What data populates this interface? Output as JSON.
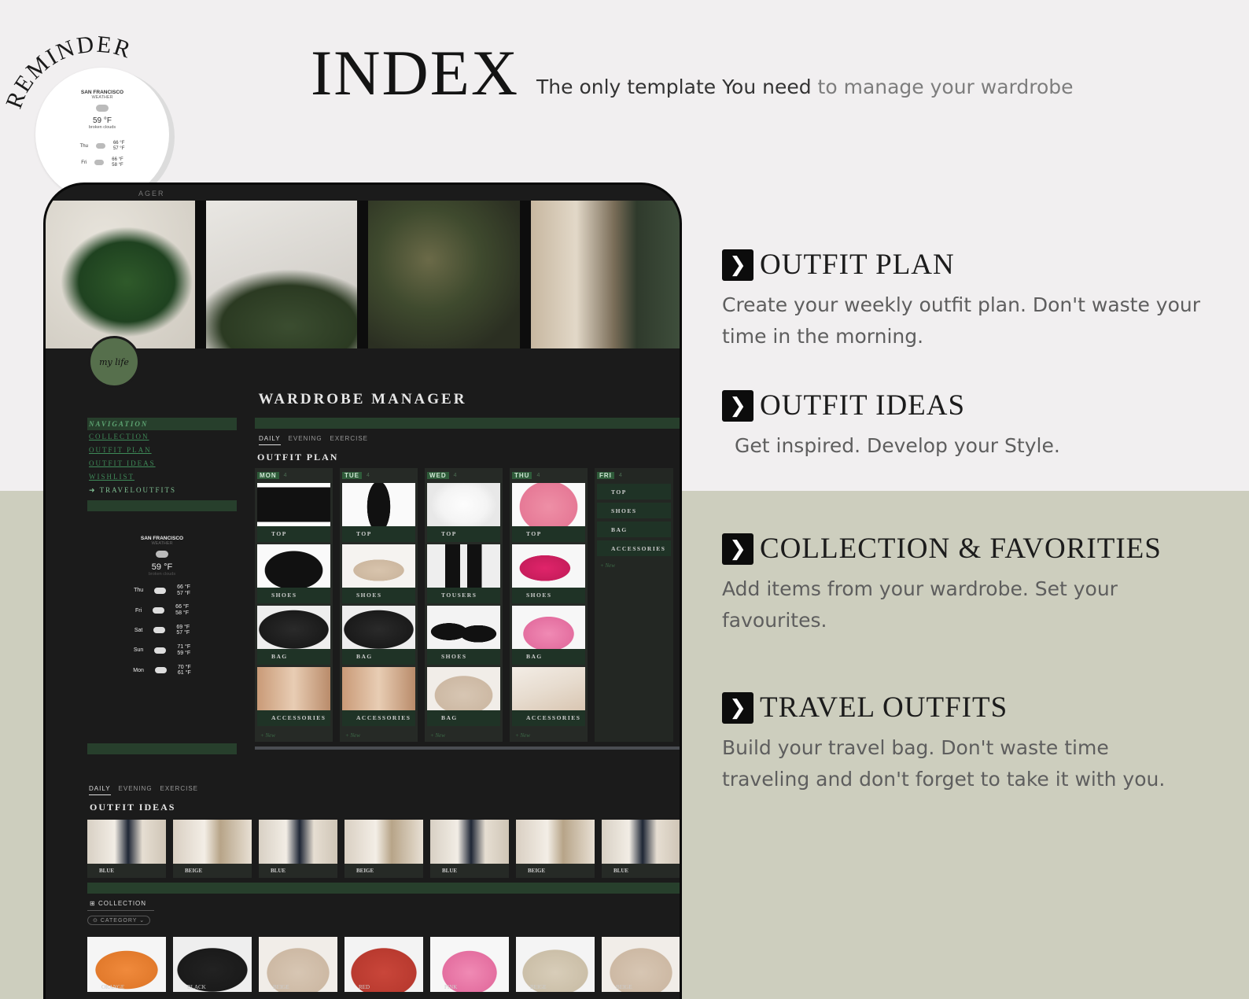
{
  "header": {
    "title": "INDEX",
    "tagline_dark": "The only template You need",
    "tagline_light": "to manage your wardrobe"
  },
  "reminder": {
    "label": "REMINDER",
    "city": "SAN FRANCISCO",
    "subtitle": "WEATHER",
    "temp": "59 °F",
    "desc": "broken clouds",
    "days": [
      {
        "day": "Thu",
        "high": "66 °F",
        "low": "57 °F"
      },
      {
        "day": "Fri",
        "high": "66 °F",
        "low": "58 °F"
      }
    ]
  },
  "app": {
    "top_label": "AGER",
    "avatar_text": "my life",
    "title": "WARDROBE MANAGER",
    "nav": {
      "header": "NAVIGATION",
      "items": [
        "COLLECTION",
        "OUTFIT PLAN",
        "OUTFIT IDEAS",
        "WISHLIST",
        "TRAVELOUTFITS"
      ]
    },
    "weather": {
      "city": "SAN FRANCISCO",
      "subtitle": "WEATHER",
      "temp": "59 °F",
      "desc": "broken clouds",
      "days": [
        {
          "day": "Thu",
          "high": "66 °F",
          "low": "57 °F"
        },
        {
          "day": "Fri",
          "high": "66 °F",
          "low": "58 °F"
        },
        {
          "day": "Sat",
          "high": "69 °F",
          "low": "57 °F"
        },
        {
          "day": "Sun",
          "high": "71 °F",
          "low": "59 °F"
        },
        {
          "day": "Mon",
          "high": "70 °F",
          "low": "61 °F"
        }
      ]
    },
    "tabs": [
      "DAILY",
      "EVENING",
      "EXERCISE"
    ],
    "outfit_plan": {
      "title": "OUTFIT PLAN",
      "new_label": "+ New",
      "columns": [
        {
          "day": "MON",
          "count": "4",
          "items": [
            "TOP",
            "SHOES",
            "BAG",
            "ACCESSORIES"
          ]
        },
        {
          "day": "TUE",
          "count": "4",
          "items": [
            "TOP",
            "SHOES",
            "BAG",
            "ACCESSORIES"
          ]
        },
        {
          "day": "WED",
          "count": "4",
          "items": [
            "TOP",
            "TOUSERS",
            "SHOES",
            "BAG"
          ]
        },
        {
          "day": "THU",
          "count": "4",
          "items": [
            "TOP",
            "SHOES",
            "BAG",
            "ACCESSORIES"
          ]
        }
      ],
      "fri": {
        "day": "FRI",
        "count": "4",
        "items": [
          "TOP",
          "SHOES",
          "BAG",
          "ACCESSORIES"
        ]
      }
    },
    "outfit_ideas": {
      "title": "OUTFIT IDEAS",
      "items": [
        "BLUE",
        "BEIGE",
        "BLUE",
        "BEIGE",
        "BLUE",
        "BEIGE",
        "BLUE"
      ]
    },
    "collection": {
      "tab": "COLLECTION",
      "filter": "CATEGORY",
      "items": [
        "ORANGE",
        "BLACK",
        "BEIGE",
        "RED",
        "PINK",
        "BEIGE",
        "BEIGE"
      ]
    }
  },
  "sections": [
    {
      "title": "OUTFIT PLAN",
      "desc": "Create your weekly outfit plan. Don't waste your time in the morning."
    },
    {
      "title": "OUTFIT IDEAS",
      "desc": "Get inspired. Develop your Style."
    },
    {
      "title": "COLLECTION & FAVORITIES",
      "desc": "Add items from your wardrobe. Set your favourites."
    },
    {
      "title": "TRAVEL OUTFITS",
      "desc": "Build your travel bag. Don't waste time traveling and don't forget to take it with you."
    }
  ],
  "colors": {
    "accent_green": "#273f2c",
    "bottom_bg": "#cdcebe",
    "top_bg": "#f1eff0"
  }
}
